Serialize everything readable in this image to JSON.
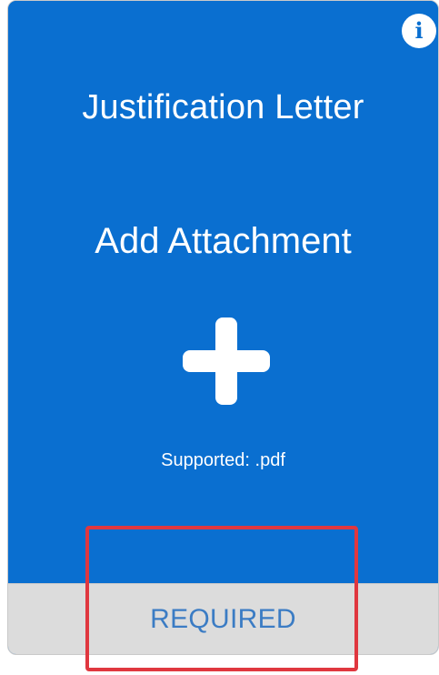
{
  "card": {
    "title": "Justification Letter",
    "action_label": "Add Attachment",
    "supported_text": "Supported: .pdf",
    "status_label": "REQUIRED",
    "info_glyph": "i",
    "icons": {
      "info": "info-icon",
      "add": "plus-icon"
    }
  },
  "colors": {
    "card_blue": "#0a6fd0",
    "footer_gray": "#dcdcdc",
    "status_text": "#3b7cc4",
    "highlight": "#e0373f"
  }
}
